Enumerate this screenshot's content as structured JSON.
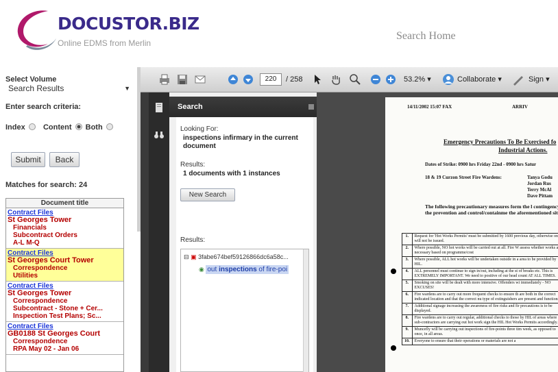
{
  "brand": {
    "name": "DOCUSTOR.BIZ",
    "tagline": "Online EDMS from Merlin",
    "accent_color": "#3a2a8a"
  },
  "header": {
    "title": "Search Home"
  },
  "left": {
    "select_volume_label": "Select Volume",
    "volume_value": "Search Results",
    "criteria_label": "Enter search criteria:",
    "radio": {
      "index": "Index",
      "content": "Content",
      "both": "Both",
      "selected": "both"
    },
    "submit_label": "Submit",
    "back_label": "Back",
    "matches_label": "Matches for search: 24",
    "doc_title_header": "Document title",
    "documents": [
      {
        "l0": "Contract Files",
        "l1": "St Georges Tower",
        "l2": [
          "Financials",
          "Subcontract Orders",
          "A-L M-Q"
        ],
        "selected": false
      },
      {
        "l0": "Contract Files",
        "l1": "St Georges Court Tower",
        "l2": [
          "Correspondence",
          "Utilities"
        ],
        "selected": true
      },
      {
        "l0": "Contract Files",
        "l1": "St Georges Tower",
        "l2": [
          "Correspondence",
          "Subcontract - Stone + Cer...",
          "Inspection Test Plans; Sc..."
        ],
        "selected": false
      },
      {
        "l0": "Contract Files",
        "l1": "GB0188 St Georges Court",
        "l2": [
          "Correspondence",
          "RPA May 02 - Jan 06"
        ],
        "selected": false
      }
    ]
  },
  "viewer": {
    "page_current": "220",
    "page_total": "/ 258",
    "zoom": "53.2%",
    "collaborate_label": "Collaborate",
    "sign_label": "Sign",
    "search_title": "Search",
    "looking_for_label": "Looking For:",
    "query": "inspections infirmary in the current document",
    "results_label": "Results:",
    "results_summary": "1 documents with 1 instances",
    "new_search_label": "New Search",
    "results_tree_label": "Results:",
    "tree_file": "3fabe674bef59126866dc6a58c...",
    "tree_hit_prefix": "out",
    "tree_hit_match": "inspections",
    "tree_hit_suffix": "of fire-poi"
  },
  "page": {
    "stamp": "14/11/2002 15:07 FAX",
    "stamp2": "ARRIV",
    "title1": "Emergency Precautions To Be Exercised fo",
    "title2": "Industrial Actions.",
    "dates": "Dates of Strike: 0900 hrs Friday 22nd - 0900 hrs Satur",
    "address": "18 & 19 Curzon Street Fire Wardens:",
    "names": [
      "Tanya Godu",
      "Jordan Rus",
      "Terry McAl",
      "Dave Pittam"
    ],
    "intro": "The following precautionary measures form the l contingency for the prevention and control/containme the aforementioned site.",
    "rows": [
      {
        "n": "1.",
        "t": "Request for 'Hot Works Permits' must be submitted by 1600 previous day, otherwise one will not be issued."
      },
      {
        "n": "2.",
        "t": "Where possible, NO hot works will be carried out at all. Fire W assess whether works are necessary based on programme/cost"
      },
      {
        "n": "3.",
        "t": "Where possible, ALL hot works will be undertaken outside in a area to be provided by HIL."
      },
      {
        "n": "4.",
        "t": "ALL personnel must continue to sign in/out, including at the st of breaks etc. This is EXTREMELY IMPORTANT. We need to positive of our head count AT ALL TIMES."
      },
      {
        "n": "5.",
        "t": "Smoking on site will be dealt with more intensive. Offenders wi immediately - NO EXCUSES!"
      },
      {
        "n": "6.",
        "t": "Fire wardens are to carry out more frequent checks to ensure th are both in the correct indicated location and that the correct nu type of extinguishers are present and functional."
      },
      {
        "n": "7.",
        "t": "Additional signage increasing the awareness of fire risks and fir precautions is to be displayed."
      },
      {
        "n": "8.",
        "t": "Fire wardens are to carry out regular, additional checks to those by HIL of areas where sub-contractors are carrying out hot work sign the HIL Hot Works Permits accordingly."
      },
      {
        "n": "9.",
        "t": "Muncefly will be carrying out inspections of fire-points three tim week, as opposed to once, in all areas."
      },
      {
        "n": "10.",
        "t": "Everyone to ensure that their operations or materials are not a"
      }
    ]
  }
}
